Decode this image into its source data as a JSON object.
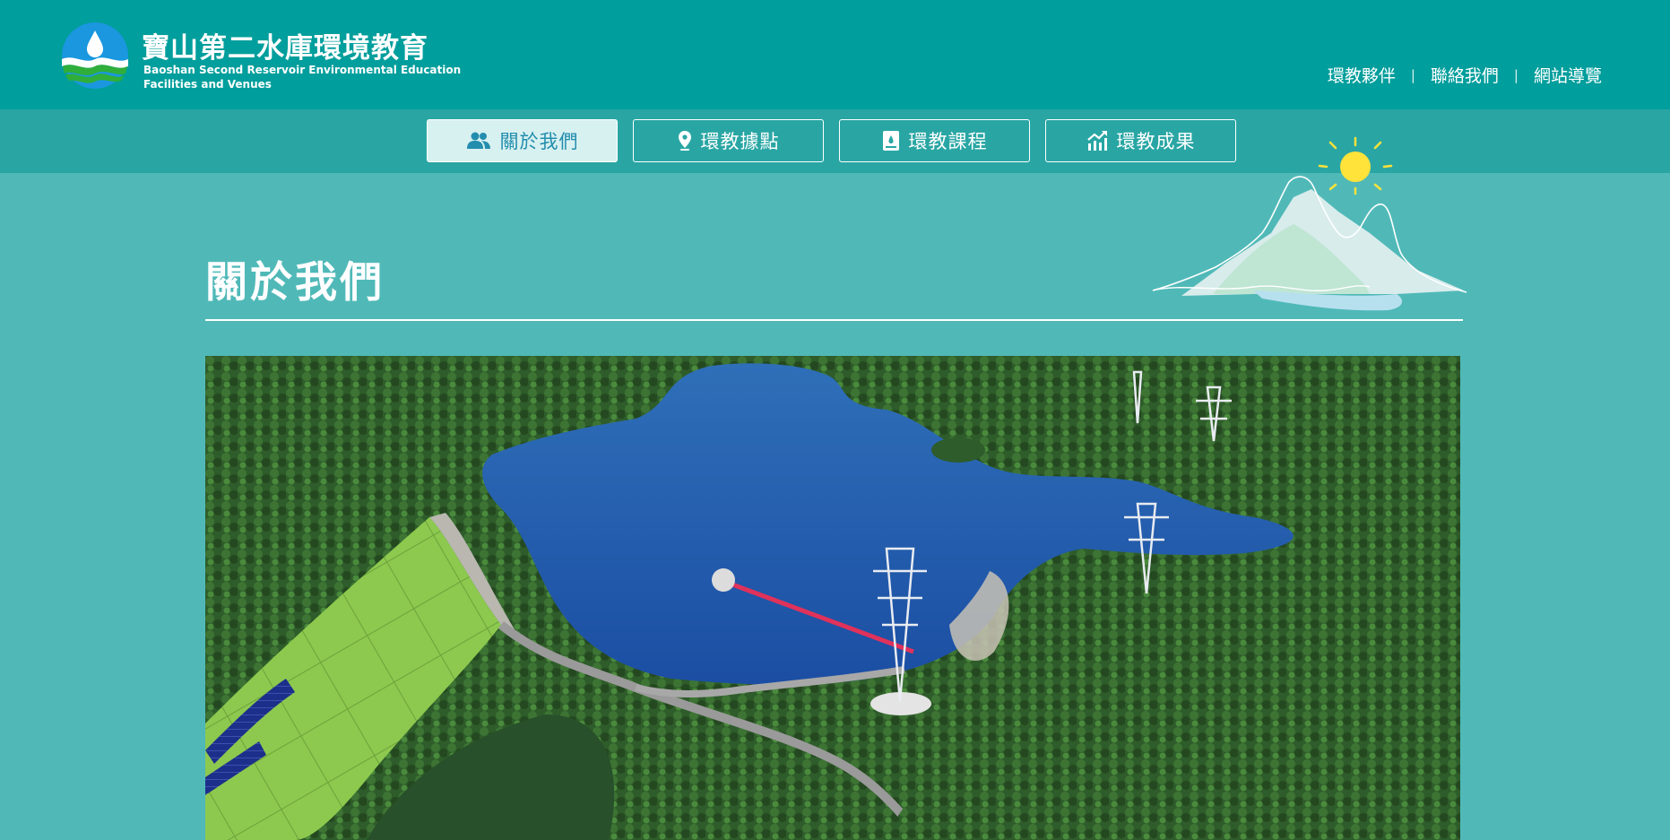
{
  "header": {
    "logo_icon": "water-drop-wave-logo",
    "title": "寶山第二水庫環境教育",
    "subtitle_line1": "Baoshan Second Reservoir Environmental Education",
    "subtitle_line2": "Facilities and Venues",
    "nav": [
      {
        "label": "環教夥伴"
      },
      {
        "label": "聯絡我們"
      },
      {
        "label": "網站導覽"
      }
    ],
    "separator": "|"
  },
  "tabs": [
    {
      "label": "關於我們",
      "icon": "users-icon",
      "active": true
    },
    {
      "label": "環教據點",
      "icon": "map-pin-icon",
      "active": false
    },
    {
      "label": "環教課程",
      "icon": "book-icon",
      "active": false
    },
    {
      "label": "環教成果",
      "icon": "chart-trend-icon",
      "active": false
    }
  ],
  "page": {
    "title": "關於我們"
  },
  "colors": {
    "header_bg": "#009e9c",
    "tabbar_bg": "#29a6a4",
    "page_bg": "#50b9b8",
    "active_tab_bg": "#d7f1f0",
    "active_tab_text": "#238dae",
    "sun": "#ffe23a"
  }
}
